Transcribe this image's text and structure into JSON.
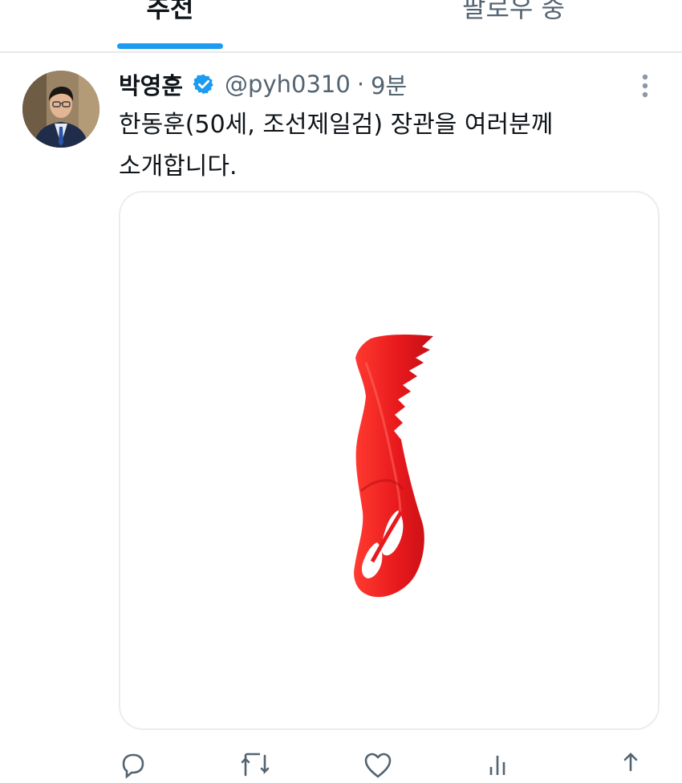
{
  "tabs": {
    "recommended": "추천",
    "following": "팔로우 중"
  },
  "tweet": {
    "display_name": "박영훈",
    "handle": "@pyh0310",
    "separator": "·",
    "time": "9분",
    "text_line1": "한동훈(50세, 조선제일검) 장관을 여러분께",
    "text_line2": "소개합니다.",
    "verified_icon": "verified-badge-icon",
    "more_icon": "more-vertical-icon",
    "accent_color": "#1d9bf0",
    "media": {
      "subject": "red-serrated-letter-opener",
      "color": "#e8191d"
    }
  },
  "actions": {
    "reply_count": "",
    "retweet_count": "",
    "like_count": "",
    "views_count": ""
  }
}
